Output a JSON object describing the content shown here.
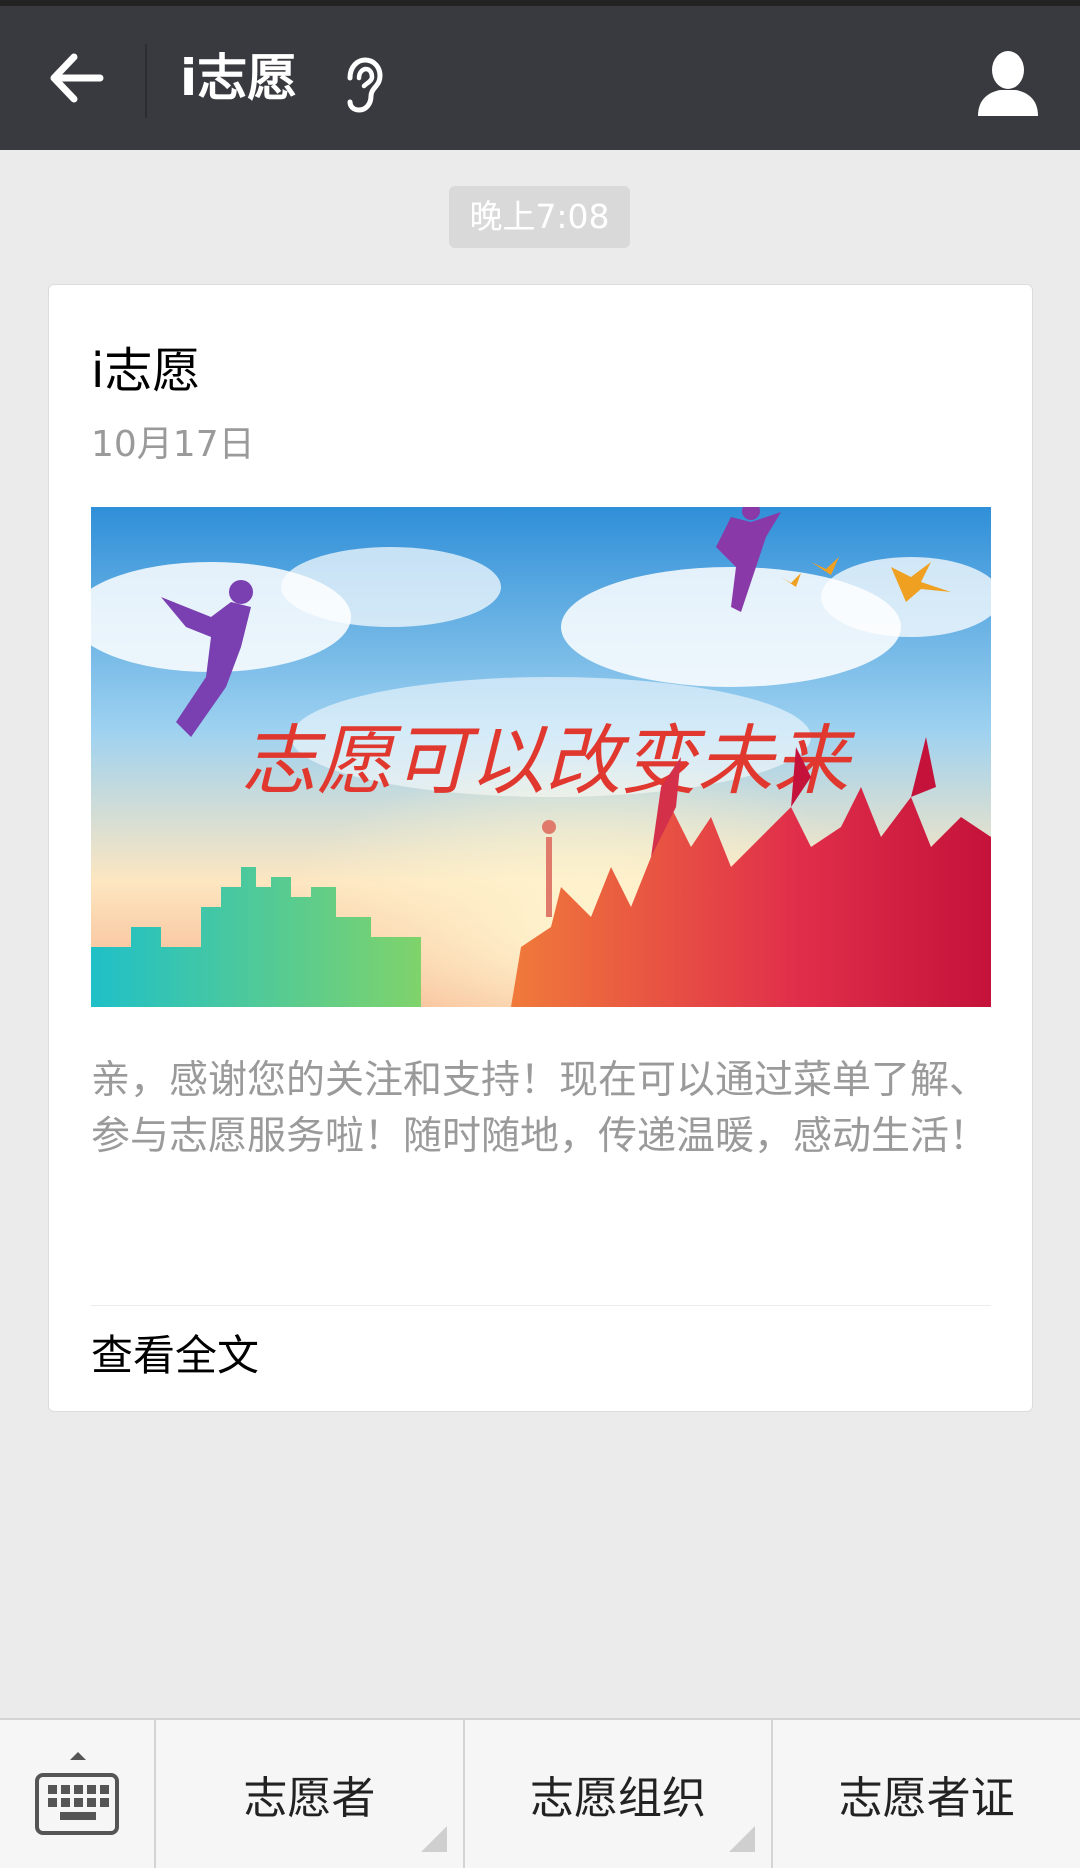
{
  "header": {
    "title": "i志愿",
    "back_icon": "arrow-left-icon",
    "voice_icon": "ear-icon",
    "profile_icon": "person-icon"
  },
  "timestamp": "晚上7:08",
  "article": {
    "title": "i志愿",
    "date": "10月17日",
    "banner_calligraphy": "志愿可以改变未来",
    "description": "亲，感谢您的关注和支持！现在可以通过菜单了解、参与志愿服务啦！随时随地，传递温暖，感动生活！",
    "read_more": "查看全文"
  },
  "bottom_menu": {
    "keyboard_icon": "keyboard-icon",
    "items": [
      {
        "label": "志愿者",
        "has_submenu": true
      },
      {
        "label": "志愿组织",
        "has_submenu": true
      },
      {
        "label": "志愿者证",
        "has_submenu": false
      }
    ]
  },
  "colors": {
    "top_bar": "#393a3f",
    "page_bg": "#ebebeb",
    "card_bg": "#ffffff",
    "secondary_text": "#9a9a9a"
  }
}
